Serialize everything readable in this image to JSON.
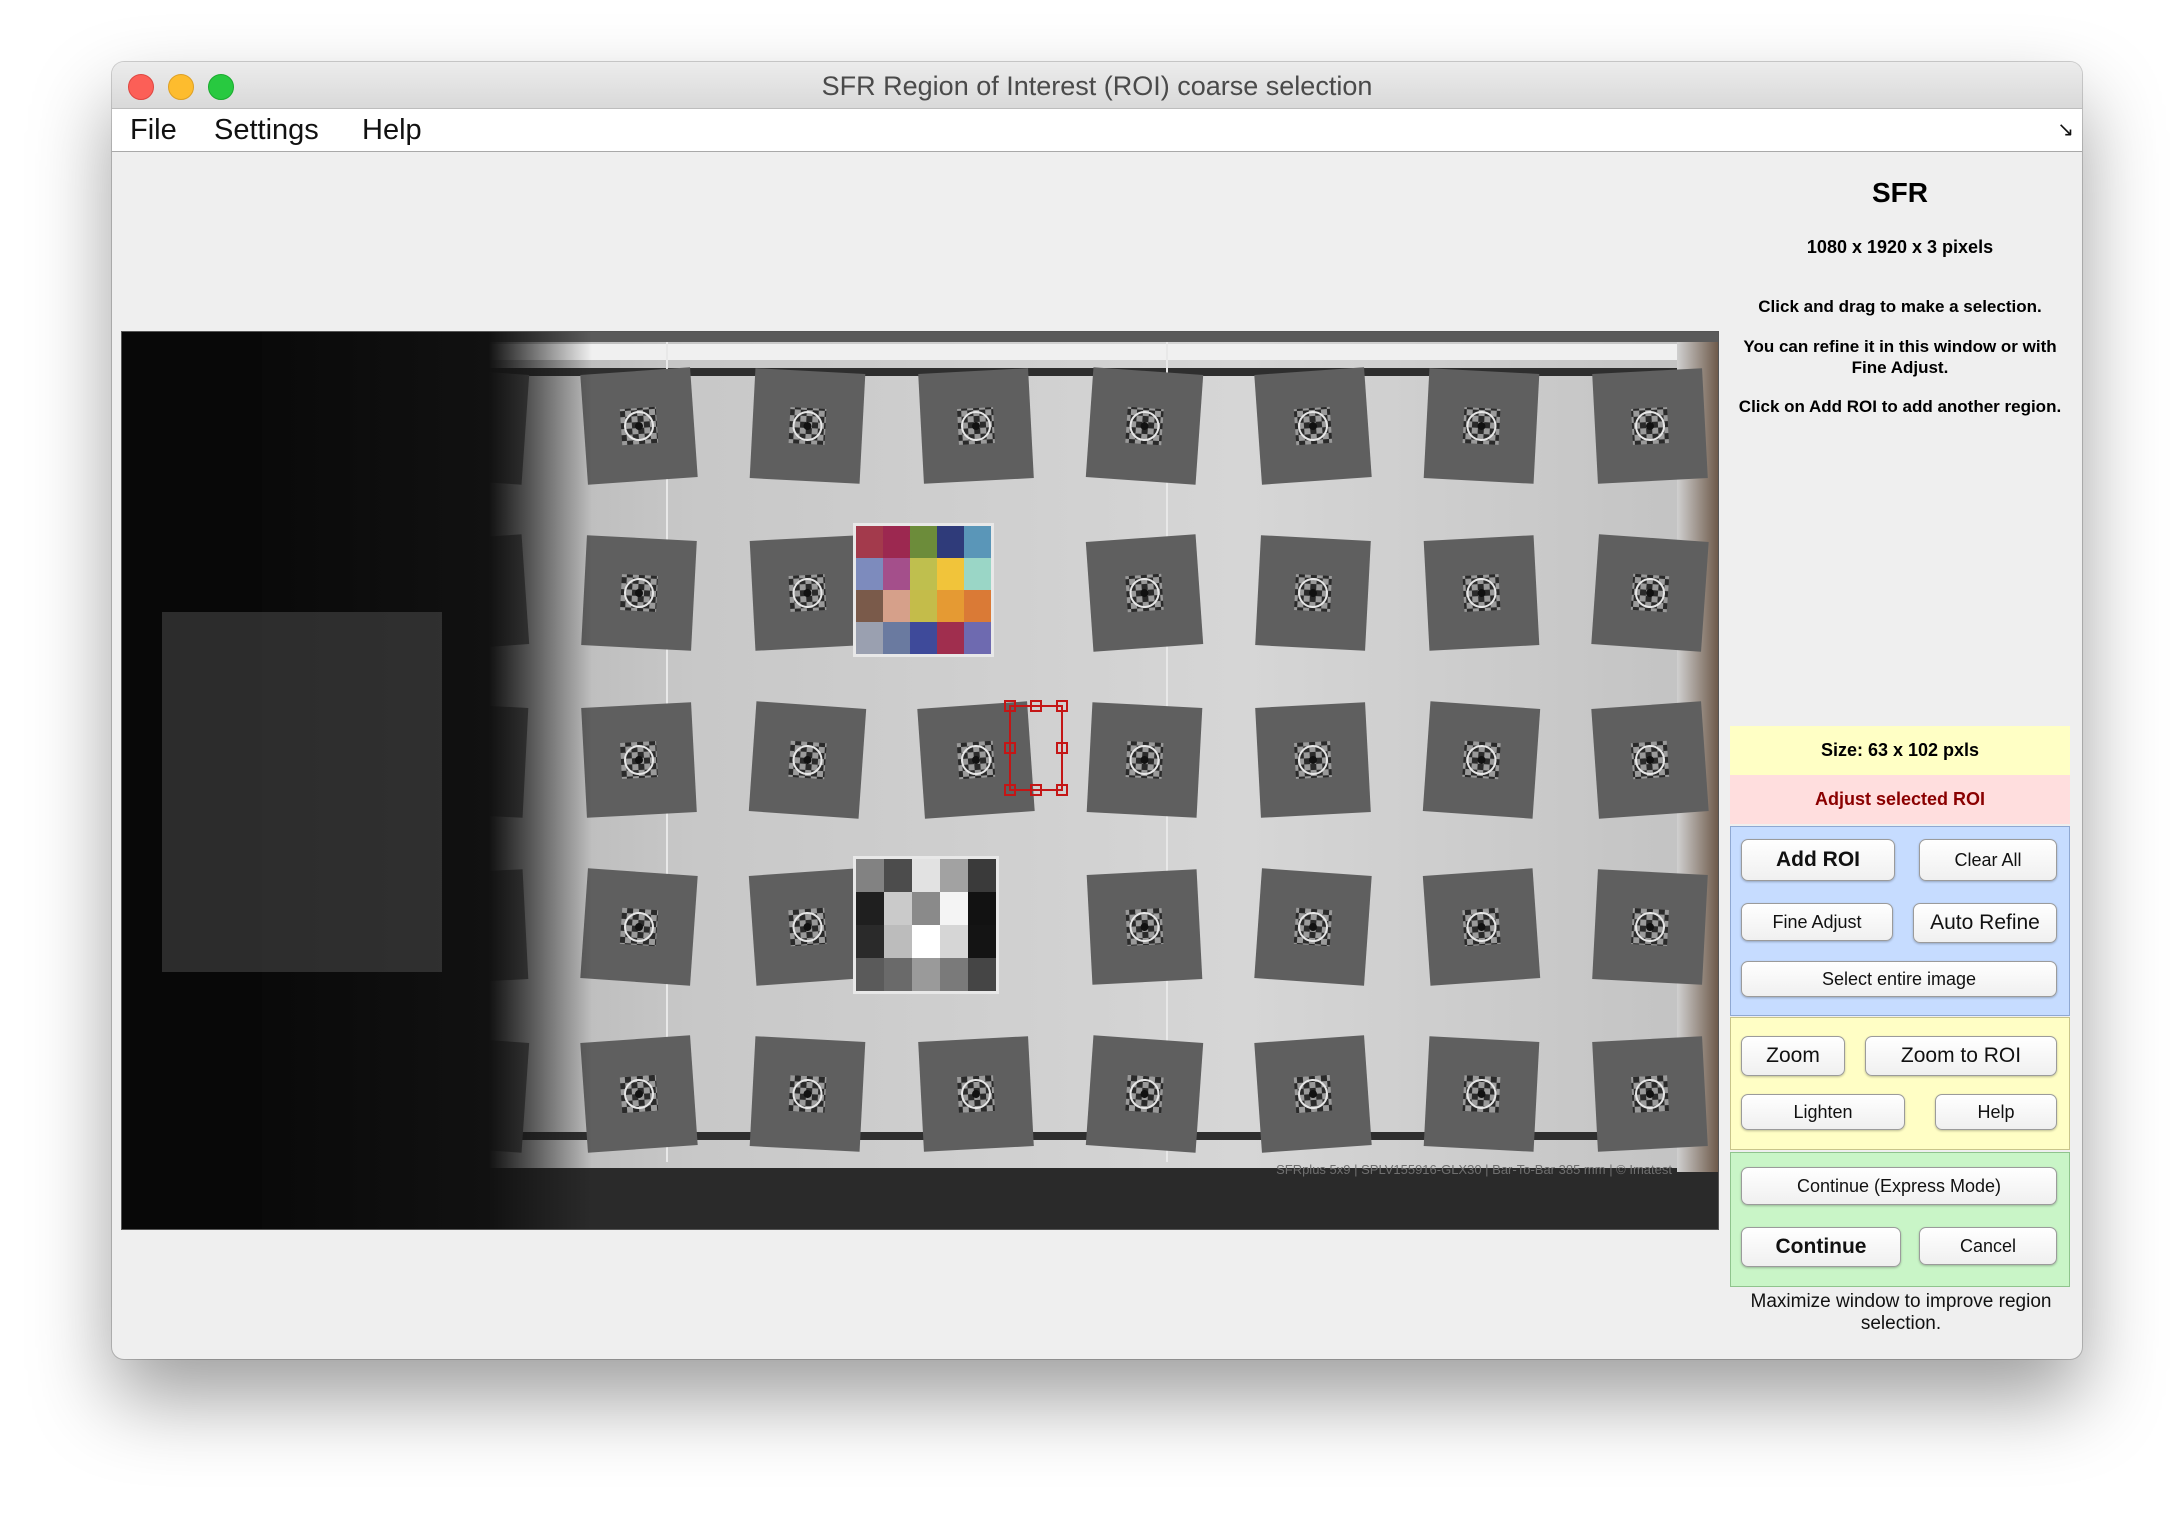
{
  "window": {
    "title": "SFR Region of Interest (ROI) coarse selection"
  },
  "menu": {
    "file": "File",
    "settings": "Settings",
    "help": "Help"
  },
  "panel": {
    "title": "SFR",
    "dimensions": "1080 x 1920 x 3  pixels",
    "instructions": [
      "Click and drag to make a selection.",
      "You can refine it in this window or with Fine Adjust.",
      "Click on Add ROI to add another region."
    ],
    "size_label": "Size:  63 x 102 pxls",
    "adjust_label": "Adjust selected ROI"
  },
  "buttons": {
    "add_roi": "Add ROI",
    "clear_all": "Clear All",
    "fine_adjust": "Fine Adjust",
    "auto_refine": "Auto Refine",
    "select_entire": "Select entire image",
    "zoom": "Zoom",
    "zoom_to_roi": "Zoom to ROI",
    "lighten": "Lighten",
    "help": "Help",
    "continue_express": "Continue (Express Mode)",
    "continue": "Continue",
    "cancel": "Cancel"
  },
  "footer_note": "Maximize window to improve region selection.",
  "chart_image": {
    "caption": "SFRplus 5x9 | SPLV155916-GLX30 | Bar-To-Bar 385 mm | © Imatest",
    "grid_rows": 5,
    "grid_cols": 9,
    "color_patches": [
      "#a33a4c",
      "#9c2850",
      "#6c8c3a",
      "#2f3b7a",
      "#5a96b8",
      "#7d8bbd",
      "#a44f8b",
      "#bfbf4e",
      "#f1c43a",
      "#9ad6c6",
      "#7a5a4a",
      "#d6a08a",
      "#c4bc4a",
      "#e59a33",
      "#da7a36",
      "#9aa0b0",
      "#6a7aa0",
      "#3e4a9a",
      "#a02e4e",
      "#6e6ab0"
    ],
    "gray_patches": [
      "#828282",
      "#4c4c4c",
      "#e2e2e2",
      "#a2a2a2",
      "#3a3a3a",
      "#1f1f1f",
      "#cacaca",
      "#8a8a8a",
      "#f4f4f4",
      "#121212",
      "#2a2a2a",
      "#bcbcbc",
      "#ffffff",
      "#d6d6d6",
      "#141414",
      "#5a5a5a",
      "#6a6a6a",
      "#9a9a9a",
      "#7a7a7a",
      "#454545"
    ]
  }
}
